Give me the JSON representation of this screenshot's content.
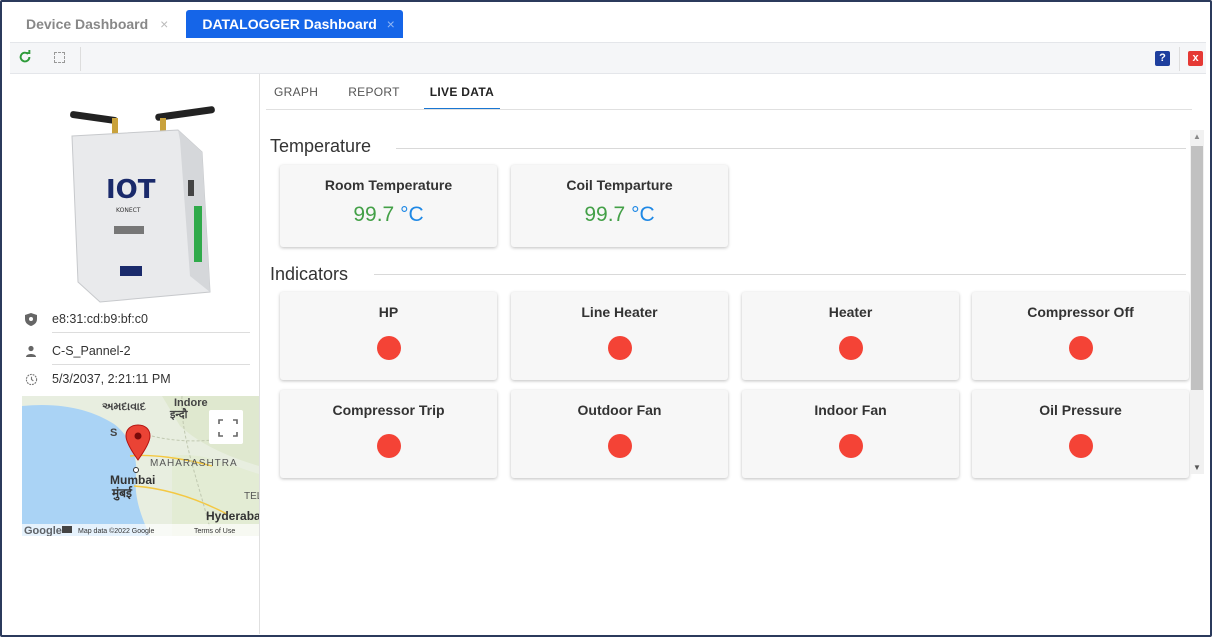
{
  "tabs": [
    {
      "label": "Device Dashboard",
      "active": false
    },
    {
      "label": "DATALOGGER Dashboard",
      "active": true
    }
  ],
  "toolbar": {
    "refresh_icon": "refresh-icon",
    "expand_icon": "fullscreen-icon",
    "help_label": "?",
    "close_label": "x"
  },
  "device": {
    "mac": "e8:31:cd:b9:bf:c0",
    "name": "C-S_Pannel-2",
    "timestamp": "5/3/2037, 2:21:11 PM",
    "brand_text": "IOT",
    "brand_sub": "KONECT"
  },
  "map": {
    "labels": {
      "ahmedabad": "અમદાવાદ",
      "indore": "Indore",
      "indore_hi": "इन्दौ",
      "surat": "S",
      "maharashtra": "MAHARASHTRA",
      "mumbai": "Mumbai",
      "mumbai_mr": "मुंबई",
      "hyderabad": "Hyderabad",
      "tel": "TEL",
      "google": "Google",
      "attribution": "Map data ©2022 Google",
      "terms": "Terms of Use"
    }
  },
  "subtabs": [
    "GRAPH",
    "REPORT",
    "LIVE DATA"
  ],
  "sections": {
    "temperature": "Temperature",
    "indicators": "Indicators"
  },
  "temperature_cards": [
    {
      "title": "Room Temperature",
      "value": "99.7",
      "unit": "°C"
    },
    {
      "title": "Coil Temparture",
      "value": "99.7",
      "unit": "°C"
    }
  ],
  "indicator_cards": [
    {
      "title": "HP",
      "status_color": "#f44336"
    },
    {
      "title": "Line Heater",
      "status_color": "#f44336"
    },
    {
      "title": "Heater",
      "status_color": "#f44336"
    },
    {
      "title": "Compressor Off",
      "status_color": "#f44336"
    },
    {
      "title": "Compressor Trip",
      "status_color": "#f44336"
    },
    {
      "title": "Outdoor Fan",
      "status_color": "#f44336"
    },
    {
      "title": "Indoor Fan",
      "status_color": "#f44336"
    },
    {
      "title": "Oil Pressure",
      "status_color": "#f44336"
    }
  ],
  "colors": {
    "accent": "#1565e8",
    "value_green": "#43a047",
    "unit_blue": "#1e88e5",
    "indicator_red": "#f44336"
  }
}
